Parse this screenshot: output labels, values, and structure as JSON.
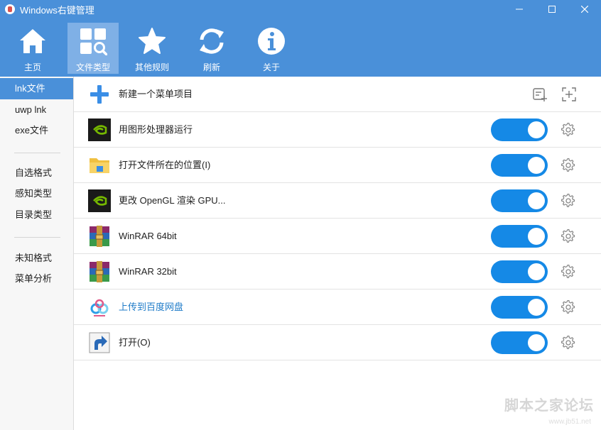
{
  "window": {
    "title": "Windows右键管理"
  },
  "toolbar": {
    "items": [
      {
        "label": "主页",
        "icon": "home-icon"
      },
      {
        "label": "文件类型",
        "icon": "file-type-icon",
        "active": true
      },
      {
        "label": "其他规则",
        "icon": "star-icon"
      },
      {
        "label": "刷新",
        "icon": "refresh-icon"
      },
      {
        "label": "关于",
        "icon": "info-icon"
      }
    ]
  },
  "sidebar": {
    "items": [
      {
        "label": "lnk文件",
        "active": true
      },
      {
        "label": "uwp lnk"
      },
      {
        "label": "exe文件"
      },
      {
        "label": "自选格式"
      },
      {
        "label": "感知类型"
      },
      {
        "label": "目录类型"
      },
      {
        "label": "未知格式"
      },
      {
        "label": "菜单分析"
      }
    ]
  },
  "list": {
    "new_item_label": "新建一个菜单项目",
    "items": [
      {
        "label": "用图形处理器运行",
        "icon": "nvidia-icon",
        "enabled": true
      },
      {
        "label": "打开文件所在的位置(I)",
        "icon": "folder-icon",
        "enabled": true
      },
      {
        "label": "更改 OpenGL 渲染 GPU...",
        "icon": "nvidia-icon",
        "enabled": true
      },
      {
        "label": "WinRAR 64bit",
        "icon": "winrar-icon",
        "enabled": true
      },
      {
        "label": "WinRAR 32bit",
        "icon": "winrar-icon",
        "enabled": true
      },
      {
        "label": "上传到百度网盘",
        "icon": "baidu-netdisk-icon",
        "enabled": true,
        "highlight": true
      },
      {
        "label": "打开(O)",
        "icon": "shortcut-arrow-icon",
        "enabled": true
      }
    ]
  },
  "watermark": {
    "main": "脚本之家论坛",
    "sub": "www.jb51.net"
  },
  "colors": {
    "accent": "#4a90d9",
    "toggle": "#1589e6",
    "link": "#1e7bc8"
  }
}
